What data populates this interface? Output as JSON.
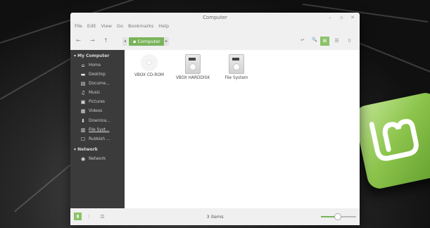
{
  "window": {
    "title": "Computer",
    "controls": [
      "–",
      "▫",
      "✕"
    ]
  },
  "menu": [
    "File",
    "Edit",
    "View",
    "Go",
    "Bookmarks",
    "Help"
  ],
  "toolbar": {
    "back": "←",
    "forward": "→",
    "up": "↑",
    "toggle": "◂",
    "crumb": "Computer",
    "crumb_end": "▸",
    "terminal": "↵",
    "search": "🔍",
    "icon_view": "⊞",
    "list_view": "☰",
    "compact_view": "⁞⁞"
  },
  "sidebar": {
    "sections": [
      {
        "title": "My Computer",
        "items": [
          {
            "icon": "home-icon",
            "glyph": "⌂",
            "label": "Home"
          },
          {
            "icon": "desktop-icon",
            "glyph": "▬",
            "label": "Desktop"
          },
          {
            "icon": "documents-icon",
            "glyph": "▤",
            "label": "Docume..."
          },
          {
            "icon": "music-icon",
            "glyph": "♫",
            "label": "Music"
          },
          {
            "icon": "pictures-icon",
            "glyph": "▣",
            "label": "Pictures"
          },
          {
            "icon": "videos-icon",
            "glyph": "▦",
            "label": "Videos"
          },
          {
            "icon": "downloads-icon",
            "glyph": "⬇",
            "label": "Downloa..."
          },
          {
            "icon": "filesystem-icon",
            "glyph": "▥",
            "label": "File Syst..."
          },
          {
            "icon": "trash-icon",
            "glyph": "☐",
            "label": "Rubbish ..."
          }
        ]
      },
      {
        "title": "Network",
        "items": [
          {
            "icon": "network-icon",
            "glyph": "◉",
            "label": "Network"
          }
        ]
      }
    ]
  },
  "files": [
    {
      "kind": "cd",
      "label": "VBOX CD-ROM"
    },
    {
      "kind": "hdd",
      "label": "VBOX HARDDISK"
    },
    {
      "kind": "hdd",
      "label": "File System"
    }
  ],
  "status": {
    "text": "3 items",
    "zoom": 0.45
  },
  "colors": {
    "accent": "#8cc26a",
    "sidebar_bg": "#3b3b3b"
  }
}
